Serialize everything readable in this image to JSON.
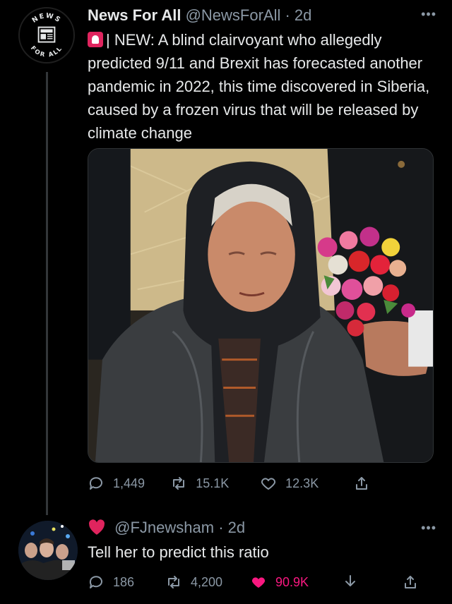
{
  "tweet": {
    "avatar_text_top": "NEWS",
    "avatar_text_bottom": "FOR ALL",
    "author_name": "News For All",
    "handle": "@NewsForAll",
    "time": "· 2d",
    "more_icon": "more-dots-icon",
    "text": "| NEW: A blind clairvoyant who allegedly predicted 9/11 and Brexit has forecasted another pandemic in 2022, this time discovered in Siberia, caused by a frozen virus that will be released by climate change",
    "stats": {
      "replies": "1,449",
      "retweets": "15.1K",
      "likes": "12.3K"
    }
  },
  "reply": {
    "handle": "@FJnewsham",
    "time": "· 2d",
    "text": "Tell her to predict this ratio",
    "stats": {
      "replies": "186",
      "retweets": "4,200",
      "likes": "90.9K"
    }
  },
  "colors": {
    "background": "#000000",
    "text": "#e7e9ea",
    "muted": "#8b98a5",
    "like": "#f91880",
    "siren": "#e0245e"
  }
}
